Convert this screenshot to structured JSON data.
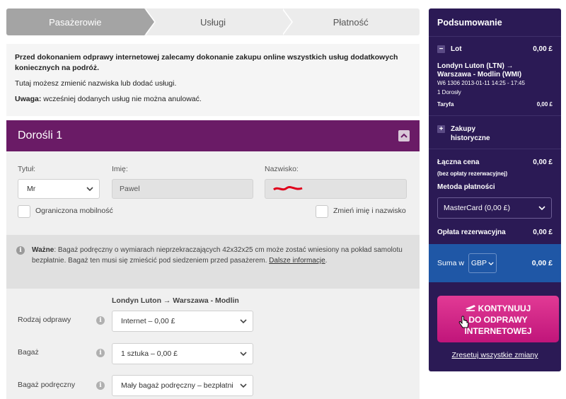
{
  "steps": [
    "Pasażerowie",
    "Usługi",
    "Płatność"
  ],
  "info": {
    "bold_text": "Przed dokonaniem odprawy internetowej zalecamy dokonanie zakupu online wszystkich usług dodatkowych koniecznych na podróż.",
    "line2": "Tutaj możesz zmienić nazwiska lub dodać usługi.",
    "warning_label": "Uwaga:",
    "warning_text": " wcześniej dodanych usług nie można anulować."
  },
  "passenger": {
    "title": "Dorośli 1",
    "title_label": "Tytuł:",
    "title_value": "Mr",
    "first_name_label": "Imię:",
    "first_name_value": "Pawel",
    "last_name_label": "Nazwisko:",
    "reduced_mobility_label": "Ograniczona mobilność",
    "change_name_label": "Zmień imię i nazwisko"
  },
  "notice": {
    "title": "Ważne",
    "text": ": Bagaż podręczny o wymiarach nieprzekraczających 42x32x25 cm może zostać wniesiony na pokład samolotu bezpłatnie. Bagaż ten musi się zmieścić pod siedzeniem przed pasażerem.",
    "link": "Dalsze informacje"
  },
  "services": {
    "route": "Londyn Luton → Warszawa - Modlin",
    "checkin_label": "Rodzaj odprawy",
    "checkin_value": "Internet – 0,00 £",
    "baggage_label": "Bagaż",
    "baggage_value": "1 sztuka – 0,00 £",
    "cabin_label": "Bagaż podręczny",
    "cabin_value": "Mały bagaż podręczny – bezpłatni"
  },
  "summary": {
    "title": "Podsumowanie",
    "flight_label": "Lot",
    "flight_price": "0,00 £",
    "route_line1": "Londyn Luton (LTN) →",
    "route_line2": "Warszawa - Modlin (WMI)",
    "flight_details": "W6 1306  2013-01-11 14:25 - 17:45",
    "passengers": "1 Dorosły",
    "fare_label": "Taryfa",
    "fare_price": "0,00 £",
    "history_label_1": "Zakupy",
    "history_label_2": "historyczne",
    "total_label": "Łączna cena",
    "total_note": "(bez opłaty rezerwacyjnej)",
    "total_price": "0,00 £",
    "payment_label": "Metoda płatności",
    "payment_value": "MasterCard (0,00 £)",
    "booking_fee_label": "Opłata rezerwacyjna",
    "booking_fee_price": "0,00 £",
    "sum_label": "Suma w",
    "currency": "GBP",
    "sum_price": "0,00 £",
    "continue_line1": "KONTYNUUJ",
    "continue_line2": "DO ODPRAWY",
    "continue_line3": "INTERNETOWEJ",
    "reset_link": "Zresetuj wszystkie zmiany"
  }
}
